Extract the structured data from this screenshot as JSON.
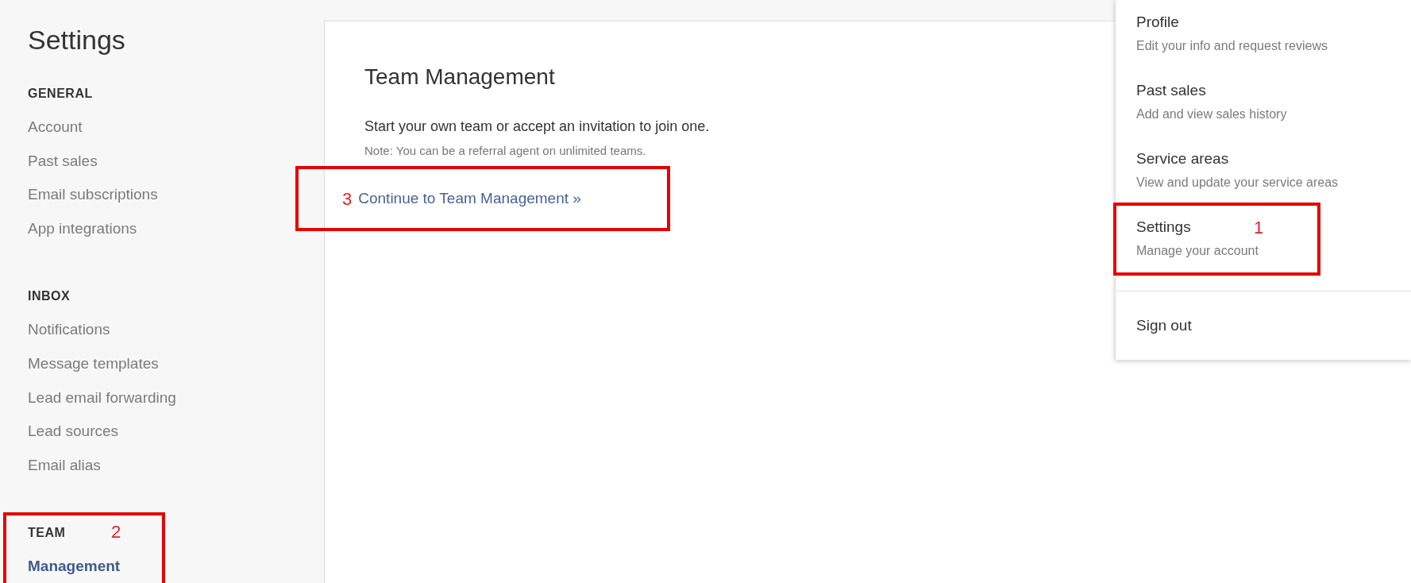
{
  "page_title": "Settings",
  "sidebar": {
    "sections": [
      {
        "heading": "GENERAL",
        "items": [
          {
            "label": "Account",
            "selected": false
          },
          {
            "label": "Past sales",
            "selected": false
          },
          {
            "label": "Email subscriptions",
            "selected": false
          },
          {
            "label": "App integrations",
            "selected": false
          }
        ]
      },
      {
        "heading": "INBOX",
        "items": [
          {
            "label": "Notifications",
            "selected": false
          },
          {
            "label": "Message templates",
            "selected": false
          },
          {
            "label": "Lead email forwarding",
            "selected": false
          },
          {
            "label": "Lead sources",
            "selected": false
          },
          {
            "label": "Email alias",
            "selected": false
          }
        ]
      },
      {
        "heading": "TEAM",
        "annotation": "2",
        "items": [
          {
            "label": "Management",
            "selected": true
          }
        ]
      }
    ]
  },
  "content": {
    "title": "Team Management",
    "text": "Start your own team or accept an invitation to join one.",
    "note": "Note: You can be a referral agent on unlimited teams.",
    "link": {
      "label": "Continue to Team Management »",
      "annotation": "3"
    }
  },
  "dropdown": {
    "items": [
      {
        "title": "Profile",
        "description": "Edit your info and request reviews"
      },
      {
        "title": "Past sales",
        "description": "Add and view sales history"
      },
      {
        "title": "Service areas",
        "description": "View and update your service areas"
      },
      {
        "title": "Settings",
        "description": "Manage your account",
        "annotation": "1"
      }
    ],
    "footer_item": "Sign out"
  }
}
